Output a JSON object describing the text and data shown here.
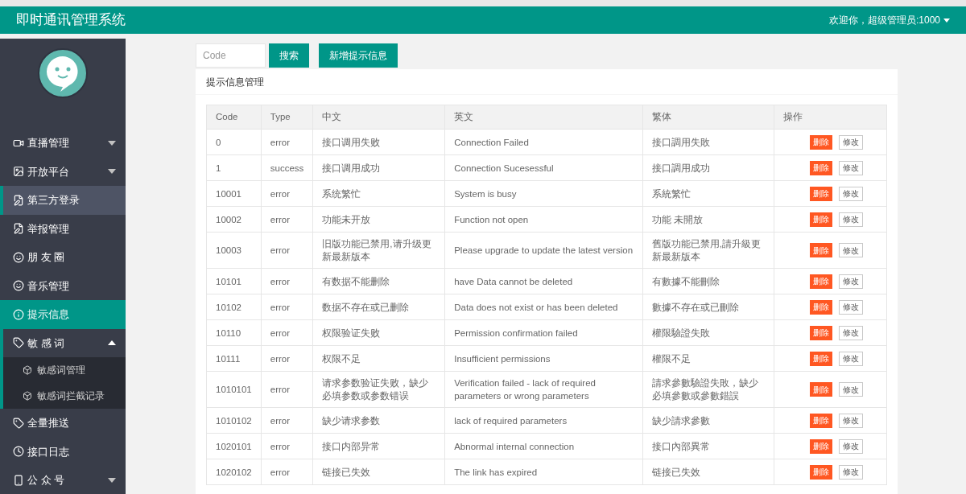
{
  "header": {
    "title": "即时通讯管理系统",
    "user": "欢迎你，超级管理员:1000"
  },
  "sidebar": {
    "items": [
      {
        "label": "直播管理",
        "selected": false,
        "highlighted": false,
        "expanded": false
      },
      {
        "label": "开放平台",
        "selected": false,
        "highlighted": false,
        "expanded": false
      },
      {
        "label": "第三方登录",
        "selected": false,
        "highlighted": true
      },
      {
        "label": "举报管理",
        "selected": false,
        "highlighted": false
      },
      {
        "label": "朋 友 圈",
        "selected": false,
        "highlighted": false
      },
      {
        "label": "音乐管理",
        "selected": false,
        "highlighted": false
      },
      {
        "label": "提示信息",
        "selected": true,
        "highlighted": false
      },
      {
        "label": "敏 感 词",
        "selected": false,
        "highlighted": false,
        "expanded": true,
        "children": [
          {
            "label": "敏感词管理"
          },
          {
            "label": "敏感词拦截记录"
          }
        ]
      },
      {
        "label": "全量推送",
        "selected": false,
        "highlighted": false
      },
      {
        "label": "接口日志",
        "selected": false,
        "highlighted": false
      },
      {
        "label": "公 众 号",
        "selected": false,
        "highlighted": false,
        "expanded": false
      }
    ]
  },
  "toolbar": {
    "search": {
      "placeholder": "Code"
    },
    "search_button": "搜索",
    "add_button": "新增提示信息"
  },
  "panel": {
    "title": "提示信息管理"
  },
  "table": {
    "columns": [
      "Code",
      "Type",
      "中文",
      "英文",
      "繁体",
      "操作"
    ],
    "rows": [
      {
        "code": "0",
        "type": "error",
        "zh": "接口调用失败",
        "en": "Connection Failed",
        "tw": "接口調用失敗",
        "actions": [
          "删除",
          "修改"
        ]
      },
      {
        "code": "1",
        "type": "success",
        "zh": "接口调用成功",
        "en": "Connection Sucesessful",
        "tw": "接口調用成功",
        "actions": [
          "删除",
          "修改"
        ]
      },
      {
        "code": "10001",
        "type": "error",
        "zh": "系统繁忙",
        "en": "System is busy",
        "tw": "系統繁忙",
        "actions": [
          "删除",
          "修改"
        ]
      },
      {
        "code": "10002",
        "type": "error",
        "zh": "功能未开放",
        "en": "Function not open",
        "tw": "功能 未開放",
        "actions": [
          "删除",
          "修改"
        ]
      },
      {
        "code": "10003",
        "type": "error",
        "zh": "旧版功能已禁用,请升级更新最新版本",
        "en": "Please upgrade to update the latest version",
        "tw": "舊版功能已禁用,請升級更新最新版本",
        "actions": [
          "删除",
          "修改"
        ]
      },
      {
        "code": "10101",
        "type": "error",
        "zh": "有数据不能删除",
        "en": "have Data cannot be deleted",
        "tw": "有數據不能刪除",
        "actions": [
          "删除",
          "修改"
        ]
      },
      {
        "code": "10102",
        "type": "error",
        "zh": "数据不存在或已删除",
        "en": "Data does not exist or has been deleted",
        "tw": "數據不存在或已刪除",
        "actions": [
          "删除",
          "修改"
        ]
      },
      {
        "code": "10110",
        "type": "error",
        "zh": "权限验证失败",
        "en": "Permission confirmation failed",
        "tw": "權限驗證失敗",
        "actions": [
          "删除",
          "修改"
        ]
      },
      {
        "code": "10111",
        "type": "error",
        "zh": "权限不足",
        "en": "Insufficient permissions",
        "tw": "權限不足",
        "actions": [
          "删除",
          "修改"
        ]
      },
      {
        "code": "1010101",
        "type": "error",
        "zh": "请求参数验证失败，缺少必填参数或参数错误",
        "en": "Verification failed - lack of required parameters or wrong parameters",
        "tw": "請求參數驗證失敗，缺少必填參數或參數錯誤",
        "actions": [
          "删除",
          "修改"
        ]
      },
      {
        "code": "1010102",
        "type": "error",
        "zh": "缺少请求参数",
        "en": "lack of required parameters",
        "tw": "缺少請求參數",
        "actions": [
          "删除",
          "修改"
        ]
      },
      {
        "code": "1020101",
        "type": "error",
        "zh": "接口内部异常",
        "en": "Abnormal internal connection",
        "tw": "接口內部異常",
        "actions": [
          "删除",
          "修改"
        ]
      },
      {
        "code": "1020102",
        "type": "error",
        "zh": "链接已失效",
        "en": "The link has expired",
        "tw": "链接已失效",
        "actions": [
          "删除",
          "修改"
        ]
      }
    ]
  }
}
